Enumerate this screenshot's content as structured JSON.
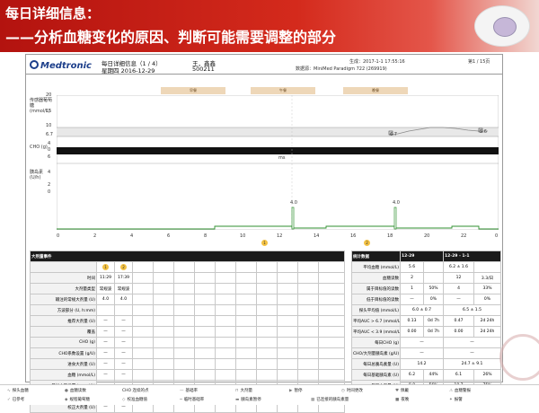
{
  "slide": {
    "title_line1": "每日详细信息：",
    "title_line2": "——分析血糖变化的原因、判断可能需要调整的部分"
  },
  "report": {
    "brand": "Medtronic",
    "report_title": "每日详细信息（1 / 4）",
    "date_line": "星期四 2016-12-29",
    "patient_name": "王，鑫鑫",
    "patient_id": "500211",
    "generated": "生成：2017-1-1 17:55:16",
    "device": "数据源：MiniMed Paradigm 722 (269919)",
    "page": "第1 / 15页",
    "meals": [
      "早餐",
      "午餐",
      "晚餐"
    ],
    "sg_axis_label": "传感器葡萄糖 (mmol/L)",
    "sg_ticks": [
      "20",
      "15",
      "10",
      "6.7",
      "4",
      "0"
    ],
    "cho_label": "CHO (g)",
    "insulin_axis_label": "胰岛素 (U/h)",
    "insulin_ticks": [
      "6",
      "4",
      "2",
      "0"
    ],
    "x_ticks": [
      "0",
      "2",
      "4",
      "6",
      "8",
      "10",
      "12",
      "14",
      "16",
      "18",
      "20",
      "22",
      "0"
    ],
    "glucose_marker_1": "6.7",
    "glucose_marker_2": "5.6",
    "bolus_1": "4.0",
    "bolus_2": "4.0",
    "bolus_mark_1": "1",
    "bolus_mark_2": "2",
    "mid_marker": "ms"
  },
  "bolus_table": {
    "header": "大剂量事件",
    "col_badges": [
      "1",
      "2"
    ],
    "rows": [
      {
        "label": "时间",
        "v1": "11:29",
        "v2": "17:39"
      },
      {
        "label": "大剂量类型",
        "v1": "常规波",
        "v2": "常规波"
      },
      {
        "label": "输注的常规大剂量 (U)",
        "v1": "4.0",
        "v2": "4.0"
      },
      {
        "label": "方波部分 (U, h:mm)",
        "v1": "",
        "v2": ""
      },
      {
        "label": "推荐大剂量 (U)",
        "v1": "—",
        "v2": "—"
      },
      {
        "label": "覆盖",
        "v1": "—",
        "v2": "—"
      },
      {
        "label": "CHO (g)",
        "v1": "—",
        "v2": "—"
      },
      {
        "label": "CHO系数设置 (g/U)",
        "v1": "—",
        "v2": "—"
      },
      {
        "label": "进食大剂量 (U)",
        "v1": "—",
        "v2": "—"
      },
      {
        "label": "血糖 (mmol/L)",
        "v1": "—",
        "v2": "—"
      },
      {
        "label": "目标血糖设置 (mmol/L)",
        "v1": "—",
        "v2": "—"
      },
      {
        "label": "胰岛素敏感系数设置 (mmol/L/U)",
        "v1": "—",
        "v2": "—"
      },
      {
        "label": "校正大剂量 (U)",
        "v1": "—",
        "v2": "—"
      },
      {
        "label": "活性胰岛素量",
        "v1": "—",
        "v2": "—"
      }
    ]
  },
  "stats_table": {
    "header": "统计数据",
    "col_a": "12-29",
    "col_b": "12-29 - 1-1",
    "rows": [
      {
        "label": "平均血糖 (mmol/L)",
        "a1": "5.6",
        "a2": "",
        "b1": "6.2 ± 1.6",
        "b2": ""
      },
      {
        "label": "血糖读数",
        "a1": "2",
        "a2": "",
        "b1": "12",
        "b2": "3.3/日"
      },
      {
        "label": "属于目标值的读数",
        "a1": "1",
        "a2": "50%",
        "b1": "4",
        "b2": "33%"
      },
      {
        "label": "低于目标值的读数",
        "a1": "—",
        "a2": "0%",
        "b1": "—",
        "b2": "0%"
      },
      {
        "label": "探头平均值 (mmol/L)",
        "a1": "6.0 ± 0.7",
        "a2": "",
        "b1": "6.5 ± 1.5",
        "b2": ""
      },
      {
        "label": "平均AUC > 6.7 (mmol/L)",
        "a1": "0.13",
        "a2": "0d 7h",
        "b1": "0.47",
        "b2": "2d 24h"
      },
      {
        "label": "平均AUC < 3.9 (mmol/L)",
        "a1": "0.00",
        "a2": "0d 7h",
        "b1": "0.00",
        "b2": "2d 24h"
      },
      {
        "label": "每日CHO (g)",
        "a1": "—",
        "a2": "",
        "b1": "—",
        "b2": ""
      },
      {
        "label": "CHO/大剂量胰岛素 (g/U)",
        "a1": "—",
        "a2": "",
        "b1": "—",
        "b2": ""
      },
      {
        "label": "每日总胰岛素量 (U)",
        "a1": "14.2",
        "a2": "",
        "b1": "24.7 ± 9.1",
        "b2": ""
      },
      {
        "label": "每日基础胰岛素 (U)",
        "a1": "6.2",
        "a2": "44%",
        "b1": "6.1",
        "b2": "26%"
      },
      {
        "label": "每日大剂量 (U)",
        "a1": "8.0",
        "a2": "56%",
        "b1": "18.7",
        "b2": "75%"
      },
      {
        "label": "马达充盈",
        "a1": "1",
        "a2": "4.9U",
        "b1": "1",
        "b2": "4.9U"
      }
    ]
  },
  "legend": {
    "row1": [
      "探头血糖",
      "血糖读数",
      "CHO 连续的点",
      "基础率",
      "大剂量",
      "暂停",
      "时间更改",
      "佩戴",
      "血糖警报"
    ],
    "row2": [
      "已参考",
      "规程葡萄糖",
      "校准血糖值",
      "临时基础率",
      "胰岛素暂停",
      "已连接的胰岛素量",
      "夜晚",
      "报警"
    ]
  },
  "colors": {
    "title_red": "#b3130f",
    "sensor_line": "#8a8a8a",
    "basal_line": "#2f8f2f",
    "bolus_line": "#2f8f2f",
    "meal_bar": "#eed7b8",
    "badge": "#f4c243"
  }
}
